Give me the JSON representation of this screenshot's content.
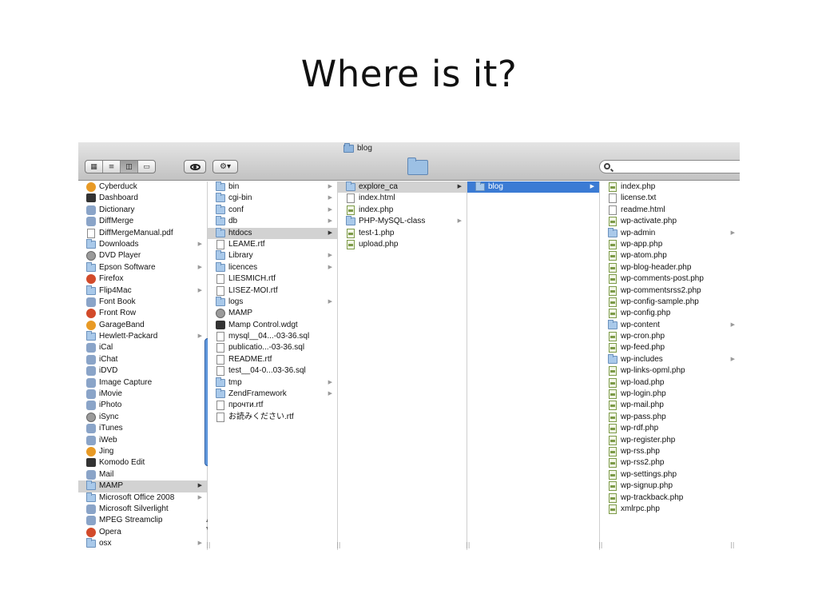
{
  "slide_title": "Where is it?",
  "window": {
    "title": "blog"
  },
  "toolbar": {
    "view_icon": "icon-view-icon",
    "view_list": "list-view-icon",
    "view_columns": "column-view-icon",
    "view_coverflow": "coverflow-view-icon",
    "quicklook": "eye-icon",
    "action": "gear-icon",
    "search_placeholder": ""
  },
  "columns": [
    {
      "items": [
        {
          "label": "Cyberduck",
          "icon": "duck-app-icon"
        },
        {
          "label": "Dashboard",
          "icon": "dashboard-app-icon"
        },
        {
          "label": "Dictionary",
          "icon": "dictionary-app-icon"
        },
        {
          "label": "DiffMerge",
          "icon": "diffmerge-app-icon"
        },
        {
          "label": "DiffMergeManual.pdf",
          "icon": "pdf-icon"
        },
        {
          "label": "Downloads",
          "icon": "folder-icon",
          "arrow": true
        },
        {
          "label": "DVD Player",
          "icon": "dvd-app-icon"
        },
        {
          "label": "Epson Software",
          "icon": "folder-icon",
          "arrow": true
        },
        {
          "label": "Firefox",
          "icon": "firefox-app-icon"
        },
        {
          "label": "Flip4Mac",
          "icon": "folder-icon",
          "arrow": true
        },
        {
          "label": "Font Book",
          "icon": "fontbook-app-icon"
        },
        {
          "label": "Front Row",
          "icon": "frontrow-app-icon"
        },
        {
          "label": "GarageBand",
          "icon": "garageband-app-icon"
        },
        {
          "label": "Hewlett-Packard",
          "icon": "folder-icon",
          "arrow": true
        },
        {
          "label": "iCal",
          "icon": "ical-app-icon"
        },
        {
          "label": "iChat",
          "icon": "ichat-app-icon"
        },
        {
          "label": "iDVD",
          "icon": "idvd-app-icon"
        },
        {
          "label": "Image Capture",
          "icon": "imagecapture-app-icon"
        },
        {
          "label": "iMovie",
          "icon": "imovie-app-icon"
        },
        {
          "label": "iPhoto",
          "icon": "iphoto-app-icon"
        },
        {
          "label": "iSync",
          "icon": "isync-app-icon"
        },
        {
          "label": "iTunes",
          "icon": "itunes-app-icon"
        },
        {
          "label": "iWeb",
          "icon": "iweb-app-icon"
        },
        {
          "label": "Jing",
          "icon": "jing-app-icon"
        },
        {
          "label": "Komodo Edit",
          "icon": "komodo-app-icon"
        },
        {
          "label": "Mail",
          "icon": "mail-app-icon"
        },
        {
          "label": "MAMP",
          "icon": "folder-icon",
          "arrow": true,
          "selected": "gray"
        },
        {
          "label": "Microsoft Office 2008",
          "icon": "folder-icon",
          "arrow": true
        },
        {
          "label": "Microsoft Silverlight",
          "icon": "silverlight-app-icon"
        },
        {
          "label": "MPEG Streamclip",
          "icon": "mpeg-app-icon"
        },
        {
          "label": "Opera",
          "icon": "opera-app-icon"
        },
        {
          "label": "osx",
          "icon": "folder-icon",
          "arrow": true
        }
      ]
    },
    {
      "items": [
        {
          "label": "bin",
          "icon": "folder-icon",
          "arrow": true
        },
        {
          "label": "cgi-bin",
          "icon": "folder-icon",
          "arrow": true
        },
        {
          "label": "conf",
          "icon": "folder-icon",
          "arrow": true
        },
        {
          "label": "db",
          "icon": "folder-icon",
          "arrow": true
        },
        {
          "label": "htdocs",
          "icon": "folder-icon",
          "arrow": true,
          "selected": "gray"
        },
        {
          "label": "LEAME.rtf",
          "icon": "document-icon"
        },
        {
          "label": "Library",
          "icon": "folder-icon",
          "arrow": true
        },
        {
          "label": "licences",
          "icon": "folder-icon",
          "arrow": true
        },
        {
          "label": "LIESMICH.rtf",
          "icon": "document-icon"
        },
        {
          "label": "LISEZ-MOI.rtf",
          "icon": "document-icon"
        },
        {
          "label": "logs",
          "icon": "folder-icon",
          "arrow": true
        },
        {
          "label": "MAMP",
          "icon": "mamp-app-icon"
        },
        {
          "label": "Mamp Control.wdgt",
          "icon": "widget-icon"
        },
        {
          "label": "mysql__04...-03-36.sql",
          "icon": "document-icon"
        },
        {
          "label": "publicatio...-03-36.sql",
          "icon": "document-icon"
        },
        {
          "label": "README.rtf",
          "icon": "document-icon"
        },
        {
          "label": "test__04-0...03-36.sql",
          "icon": "document-icon"
        },
        {
          "label": "tmp",
          "icon": "folder-icon",
          "arrow": true
        },
        {
          "label": "ZendFramework",
          "icon": "folder-icon",
          "arrow": true
        },
        {
          "label": "прочти.rtf",
          "icon": "document-icon"
        },
        {
          "label": "お読みください.rtf",
          "icon": "document-icon"
        }
      ]
    },
    {
      "items": [
        {
          "label": "explore_ca",
          "icon": "folder-icon",
          "arrow": true,
          "selected": "gray"
        },
        {
          "label": "index.html",
          "icon": "html-file-icon"
        },
        {
          "label": "index.php",
          "icon": "php-file-icon"
        },
        {
          "label": "PHP-MySQL-class",
          "icon": "folder-icon",
          "arrow": true
        },
        {
          "label": "test-1.php",
          "icon": "php-file-icon"
        },
        {
          "label": "upload.php",
          "icon": "php-file-icon"
        }
      ]
    },
    {
      "items": [
        {
          "label": "blog",
          "icon": "folder-icon",
          "arrow": true,
          "selected": "blue"
        }
      ]
    },
    {
      "items": [
        {
          "label": "index.php",
          "icon": "php-file-icon"
        },
        {
          "label": "license.txt",
          "icon": "text-file-icon"
        },
        {
          "label": "readme.html",
          "icon": "html-file-icon"
        },
        {
          "label": "wp-activate.php",
          "icon": "php-file-icon"
        },
        {
          "label": "wp-admin",
          "icon": "folder-icon",
          "arrow": true
        },
        {
          "label": "wp-app.php",
          "icon": "php-file-icon"
        },
        {
          "label": "wp-atom.php",
          "icon": "php-file-icon"
        },
        {
          "label": "wp-blog-header.php",
          "icon": "php-file-icon"
        },
        {
          "label": "wp-comments-post.php",
          "icon": "php-file-icon"
        },
        {
          "label": "wp-commentsrss2.php",
          "icon": "php-file-icon"
        },
        {
          "label": "wp-config-sample.php",
          "icon": "php-file-icon"
        },
        {
          "label": "wp-config.php",
          "icon": "php-file-icon"
        },
        {
          "label": "wp-content",
          "icon": "folder-icon",
          "arrow": true
        },
        {
          "label": "wp-cron.php",
          "icon": "php-file-icon"
        },
        {
          "label": "wp-feed.php",
          "icon": "php-file-icon"
        },
        {
          "label": "wp-includes",
          "icon": "folder-icon",
          "arrow": true
        },
        {
          "label": "wp-links-opml.php",
          "icon": "php-file-icon"
        },
        {
          "label": "wp-load.php",
          "icon": "php-file-icon"
        },
        {
          "label": "wp-login.php",
          "icon": "php-file-icon"
        },
        {
          "label": "wp-mail.php",
          "icon": "php-file-icon"
        },
        {
          "label": "wp-pass.php",
          "icon": "php-file-icon"
        },
        {
          "label": "wp-rdf.php",
          "icon": "php-file-icon"
        },
        {
          "label": "wp-register.php",
          "icon": "php-file-icon"
        },
        {
          "label": "wp-rss.php",
          "icon": "php-file-icon"
        },
        {
          "label": "wp-rss2.php",
          "icon": "php-file-icon"
        },
        {
          "label": "wp-settings.php",
          "icon": "php-file-icon"
        },
        {
          "label": "wp-signup.php",
          "icon": "php-file-icon"
        },
        {
          "label": "wp-trackback.php",
          "icon": "php-file-icon"
        },
        {
          "label": "xmlrpc.php",
          "icon": "php-file-icon"
        }
      ]
    }
  ],
  "colors": {
    "selection_blue": "#3b7bd4",
    "selection_gray": "#d2d2d2",
    "folder_blue": "#a9c9ea",
    "toolbar_top": "#e4e4e4",
    "toolbar_bottom": "#c2c2c2"
  }
}
